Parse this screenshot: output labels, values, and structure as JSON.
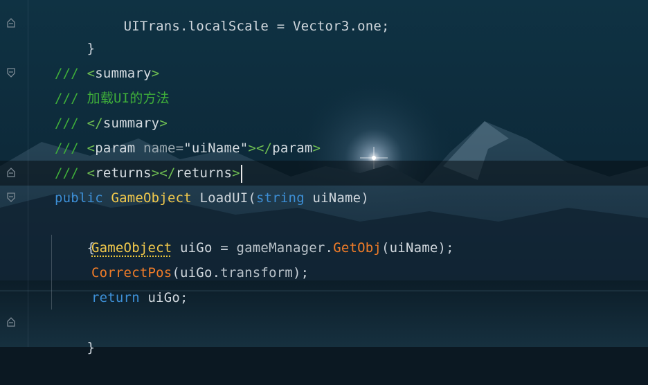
{
  "editor": {
    "lines": {
      "l0": {
        "text": "UITrans.localScale = Vector3.one;"
      },
      "l1": {
        "brace": "}"
      },
      "l2": {
        "p1": "/// ",
        "t1": "<",
        "n1": "summary",
        "t2": ">"
      },
      "l3": {
        "p1": "/// ",
        "text": "加载UI的方法"
      },
      "l4": {
        "p1": "/// ",
        "t1": "</",
        "n1": "summary",
        "t2": ">"
      },
      "l5": {
        "p1": "/// ",
        "t1": "<",
        "n1": "param",
        "attr": " name=",
        "str": "\"uiName\"",
        "t2": "></",
        "n2": "param",
        "t3": ">"
      },
      "l6": {
        "p1": "/// ",
        "t1": "<",
        "n1": "returns",
        "t2": "></",
        "n2": "returns",
        "t3": ">"
      },
      "l7": {
        "kw1": "public",
        "sp1": " ",
        "type": "GameObject",
        "sp2": " ",
        "fn": "LoadUI",
        "p1": "(",
        "kw2": "string",
        "sp3": " ",
        "param": "uiName",
        "p2": ")"
      },
      "l8": {
        "brace": "{"
      },
      "l9": {
        "type": "GameObject",
        "sp1": " ",
        "var": "uiGo",
        "op": " = ",
        "obj": "gameManager",
        "dot": ".",
        "call": "GetObj",
        "p1": "(",
        "arg": "uiName",
        "p2": ");"
      },
      "l10": {
        "call": "CorrectPos",
        "p1": "(",
        "arg": "uiGo",
        "dot": ".",
        "prop": "transform",
        "p2": ");"
      },
      "l11": {
        "kw": "return",
        "sp": " ",
        "var": "uiGo",
        "p": ";"
      },
      "l12": {
        "brace": "}"
      }
    }
  },
  "colors": {
    "comment": "#3fae3a",
    "keyword": "#3d8fd6",
    "type": "#f2c94c",
    "method_call": "#f07c28",
    "string": "#6fbf52"
  },
  "icons": {
    "fold_marker": "fold-marker-icon"
  }
}
